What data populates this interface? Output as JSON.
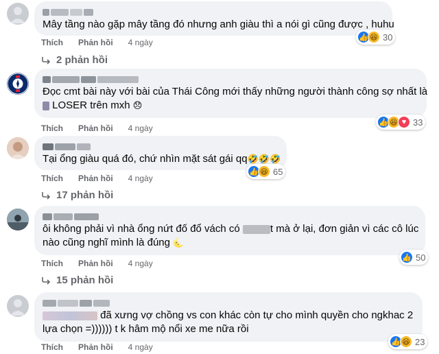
{
  "actions": {
    "like": "Thích",
    "reply": "Phản hồi"
  },
  "comments": [
    {
      "text_lines": [
        "Mây tầng nào gặp mây tầng đó nhưng anh giàu thì a nói gì cũng được , huhu"
      ],
      "time": "4 ngày",
      "reactions": {
        "count": "30",
        "icons": [
          "like-icon",
          "haha-icon"
        ]
      },
      "replies": "2 phản hồi"
    },
    {
      "text_lines": [
        "Đọc cmt bài này với bài của Thái Công mới thấy những người thành công sợ nhất là",
        "LOSER trên mxh"
      ],
      "time": "4 ngày",
      "reactions": {
        "count": "33",
        "icons": [
          "like-icon",
          "haha-icon",
          "love-icon"
        ]
      }
    },
    {
      "text_lines": [
        "Tại ổng giàu quá đó, chứ nhìn mặt sát gái qq"
      ],
      "time": "4 ngày",
      "reactions": {
        "count": "65",
        "icons": [
          "like-icon",
          "haha-icon"
        ]
      },
      "replies": "17 phản hồi"
    },
    {
      "text_lines": [
        "ôi không phải vì nhà ổng nứt đố đổ vách có",
        "t mà ở lại, đơn giản vì các cô lúc",
        "nào cũng nghĩ mình là đúng"
      ],
      "time": "4 ngày",
      "reactions": {
        "count": "50",
        "icons": [
          "like-icon"
        ]
      },
      "replies": "15 phản hồi"
    },
    {
      "text_lines": [
        "đã xưng vợ chồng vs con khác còn tự cho mình quyền cho ngkhac 2",
        "lựa chọn =)))))) t k hâm mộ nổi xe me nữa rồi"
      ],
      "time": "4 ngày",
      "reactions": {
        "count": "23",
        "icons": [
          "like-icon",
          "haha-icon"
        ]
      }
    }
  ]
}
